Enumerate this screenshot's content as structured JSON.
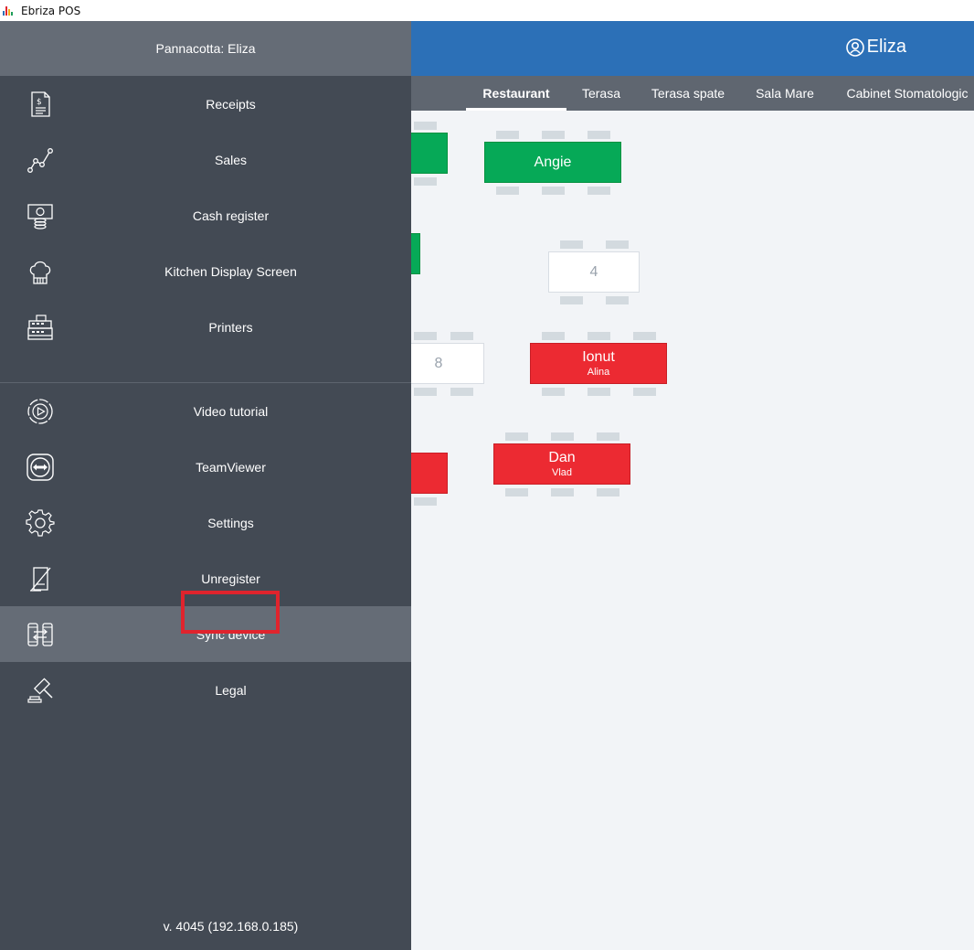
{
  "window": {
    "title": "Ebriza POS",
    "logo_colors": [
      "#e0242d",
      "#f2b01e",
      "#1f9e5a",
      "#2c70b7"
    ]
  },
  "topbar": {
    "user_icon": "user-circle-icon",
    "user_name": "Eliza"
  },
  "tabs": [
    {
      "label": "Restaurant",
      "active": true
    },
    {
      "label": "Terasa",
      "active": false
    },
    {
      "label": "Terasa spate",
      "active": false
    },
    {
      "label": "Sala Mare",
      "active": false
    },
    {
      "label": "Cabinet Stomatologic",
      "active": false
    }
  ],
  "tables": [
    {
      "name": "",
      "waiter": "",
      "status": "green"
    },
    {
      "name": "Angie",
      "waiter": "",
      "status": "green"
    },
    {
      "name": "",
      "waiter": "",
      "status": "green"
    },
    {
      "name": "4",
      "waiter": "",
      "status": "white"
    },
    {
      "name": "8",
      "waiter": "",
      "status": "white"
    },
    {
      "name": "Ionut",
      "waiter": "Alina",
      "status": "red"
    },
    {
      "name": "",
      "waiter": "",
      "status": "red"
    },
    {
      "name": "Dan",
      "waiter": "Vlad",
      "status": "red"
    }
  ],
  "menu": {
    "header": "Pannacotta: Eliza",
    "items": [
      {
        "label": "Receipts",
        "icon": "receipt-icon"
      },
      {
        "label": "Sales",
        "icon": "sales-chart-icon"
      },
      {
        "label": "Cash register",
        "icon": "cash-register-icon"
      },
      {
        "label": "Kitchen Display Screen",
        "icon": "chef-hat-icon"
      },
      {
        "label": "Printers",
        "icon": "printer-icon"
      },
      {
        "label": "Video tutorial",
        "icon": "video-play-icon"
      },
      {
        "label": "TeamViewer",
        "icon": "teamviewer-icon"
      },
      {
        "label": "Settings",
        "icon": "gear-icon"
      },
      {
        "label": "Unregister",
        "icon": "unregister-device-icon"
      },
      {
        "label": "Sync device",
        "icon": "sync-device-icon",
        "active": true
      },
      {
        "label": "Legal",
        "icon": "gavel-icon"
      }
    ],
    "version": "v. 4045 (192.168.0.185)"
  },
  "colors": {
    "topbar": "#2c70b7",
    "menu_bg": "#434a54",
    "menu_active": "#656c76",
    "table_occupied_green": "#06a957",
    "table_occupied_red": "#ec2a32",
    "highlight": "#e0242d"
  }
}
